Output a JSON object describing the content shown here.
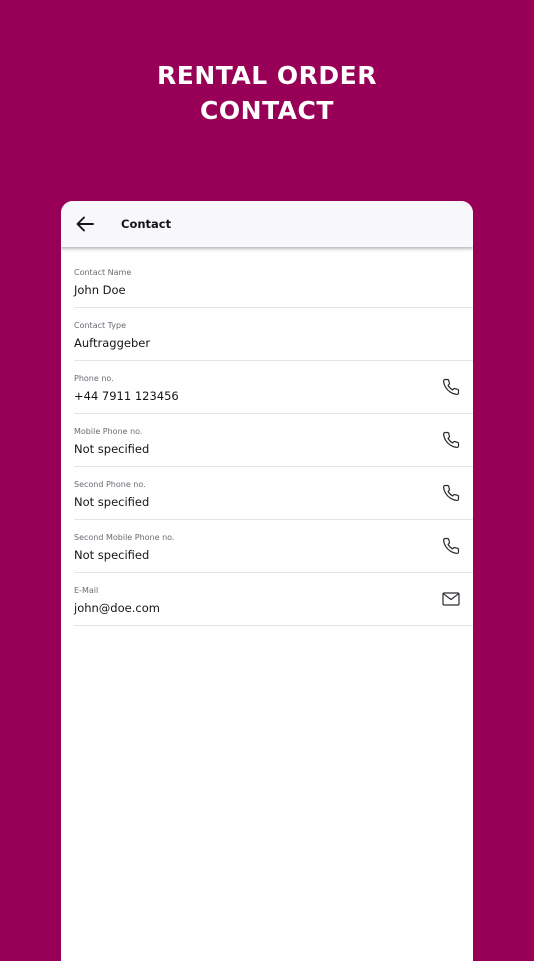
{
  "promo": {
    "title_line1": "RENTAL ORDER",
    "title_line2": "CONTACT"
  },
  "colors": {
    "background": "#980058",
    "header_background": "#f8f8fc",
    "text_primary": "#151515",
    "text_secondary": "#6a6a73"
  },
  "header": {
    "back_icon": "arrow-left-icon",
    "title": "Contact"
  },
  "fields": [
    {
      "label": "Contact Name",
      "value": "John Doe"
    },
    {
      "label": "Contact Type",
      "value": "Auftraggeber"
    },
    {
      "label": "Phone no.",
      "value": "+44 7911 123456",
      "action_icon": "phone-icon"
    },
    {
      "label": "Mobile Phone no.",
      "value": "Not specified",
      "action_icon": "phone-icon"
    },
    {
      "label": "Second Phone no.",
      "value": "Not specified",
      "action_icon": "phone-icon"
    },
    {
      "label": "Second Mobile Phone no.",
      "value": "Not specified",
      "action_icon": "phone-icon"
    },
    {
      "label": "E-Mail",
      "value": "john@doe.com",
      "action_icon": "mail-icon"
    }
  ]
}
